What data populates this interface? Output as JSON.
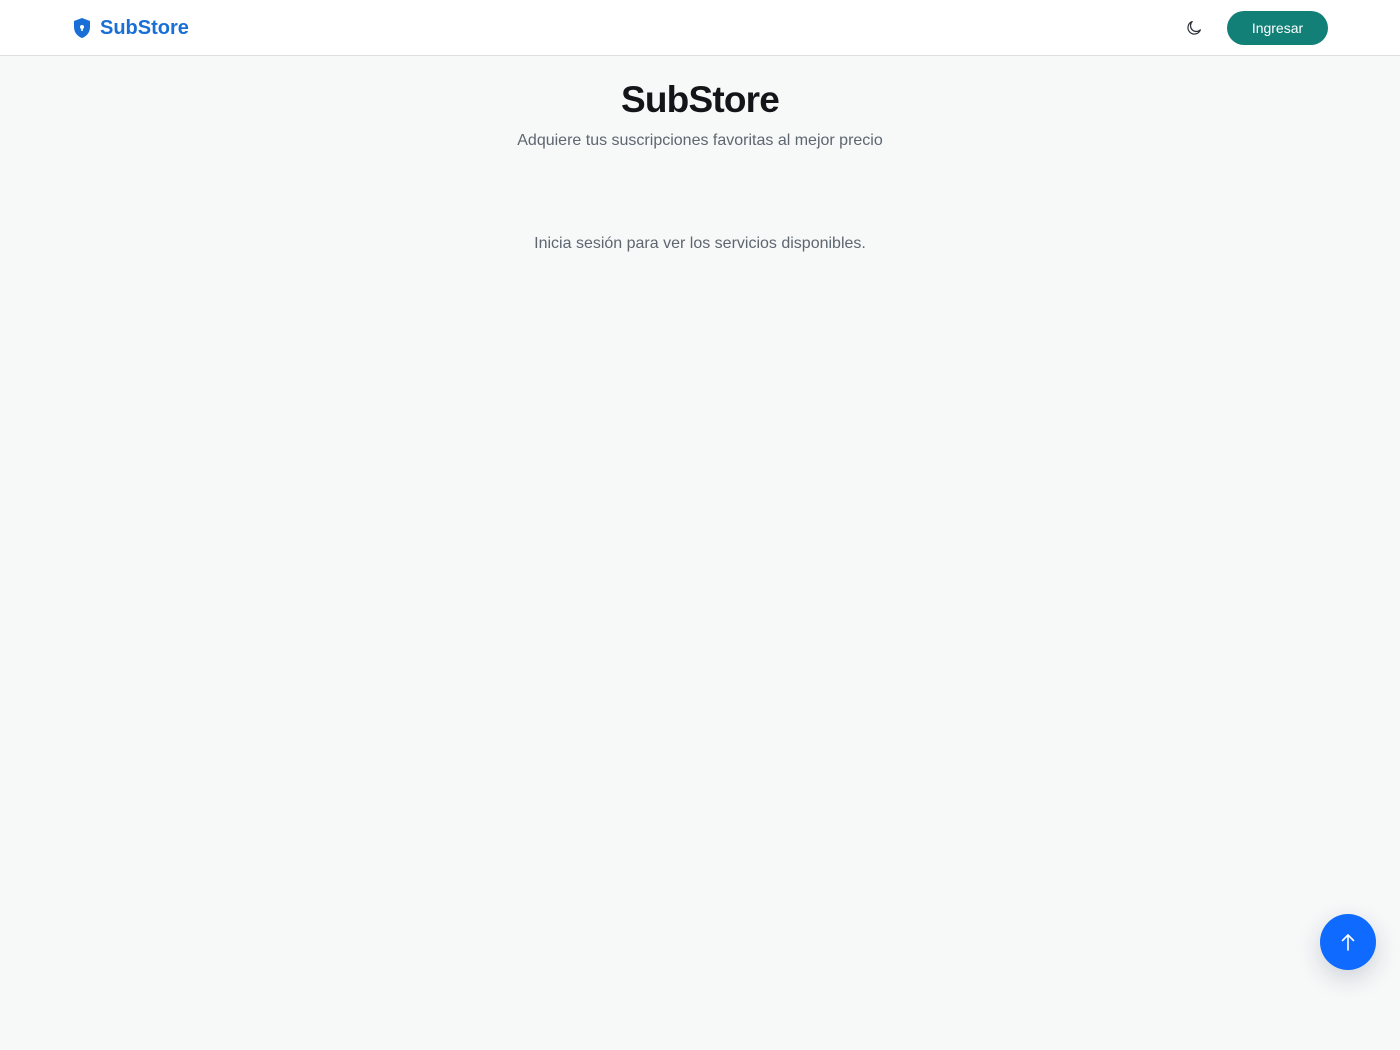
{
  "navbar": {
    "brand_name": "SubStore",
    "brand_icon": "shield-icon",
    "theme_toggle_icon": "moon-icon",
    "login_label": "Ingresar"
  },
  "hero": {
    "title": "SubStore",
    "subtitle": "Adquiere tus suscripciones favoritas al mejor precio"
  },
  "main": {
    "login_notice": "Inicia sesión para ver los servicios disponibles."
  },
  "scroll_top": {
    "icon": "arrow-up-icon"
  },
  "colors": {
    "brand": "#1a6fd6",
    "login_button": "#138078",
    "scroll_top_button": "#0f6bff",
    "background": "#f7f8f8"
  }
}
